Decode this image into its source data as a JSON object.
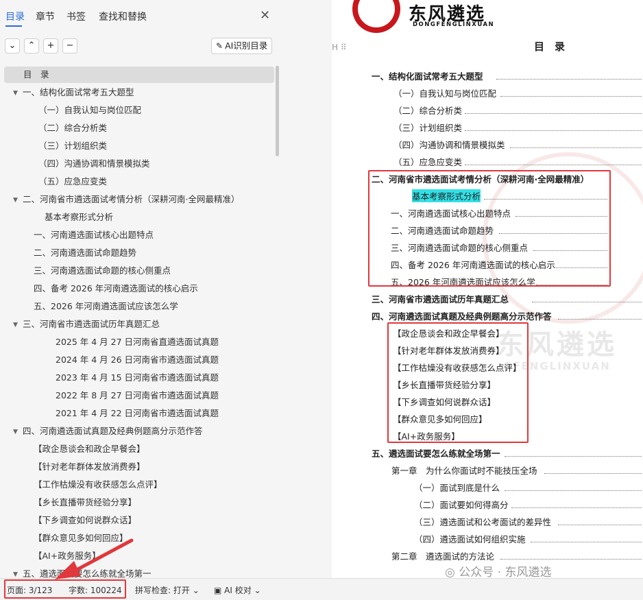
{
  "left_panel": {
    "tabs": [
      "目录",
      "章节",
      "书签",
      "查找和替换"
    ],
    "close_icon": "close-icon",
    "toolbar": {
      "ai_button": "AI识别目录"
    },
    "toc": [
      "目　录",
      "一、结构化面试常考五大题型",
      "（一）自我认知与岗位匹配",
      "（二）综合分析类",
      "（三）计划组织类",
      "（四）沟通协调和情景模拟类",
      "（五）应急应变类",
      "二、河南省市遴选面试考情分析（深耕河南·全网最精准）",
      "基本考察形式分析",
      "一、河南遴选面试核心出题特点",
      "二、河南遴选面试命题趋势",
      "三、河南遴选面试命题的核心侧重点",
      "四、备考 2026 年河南遴选面试的核心启示",
      "五、2026 年河南遴选面试应该怎么学",
      "三、河南省市遴选面试历年真题汇总",
      "2025 年 4 月 27 日河南省直遴选面试真题",
      "2024 年 4 月 26 日河南省市遴选面试真题",
      "2023 年 4 月 15 日河南省市遴选面试真题",
      "2022 年 8 月 27 日河南省市遴选面试真题",
      "2021 年 4 月 22 日河南省市遴选面试真题",
      "四、河南遴选面试真题及经典例题高分示范作答",
      "【政企恳谈会和政企早餐会】",
      "【针对老年群体发放消费券】",
      "【工作枯燥没有收获感怎么点评】",
      "【乡长直播带货经验分享】",
      "【下乡调查如何说群众话】",
      "【群众意见多如何回应】",
      "【AI+政务服务】",
      "五、遴选面试要怎么练就全场第一"
    ]
  },
  "status_bar": {
    "page": "页面: 3/123",
    "words": "字数: 100224",
    "spell": "拼写检查: 打开",
    "ai_check": "AI 校对"
  },
  "document": {
    "logo_text": "东风遴选",
    "logo_sub": "DONGFENGLINXUAN",
    "title": "目　录",
    "lines": [
      "一、结构化面试常考五大题型",
      "（一）自我认知与岗位匹配",
      "（二）综合分析类",
      "（三）计划组织类",
      "（四）沟通协调和情景模拟类",
      "（五）应急应变类",
      "二、河南省市遴选面试考情分析（深耕河南·全网最精准）",
      "基本考察形式分析",
      "一、河南遴选面试核心出题特点",
      "二、河南遴选面试命题趋势",
      "三、河南遴选面试命题的核心侧重点",
      "四、备考 2026 年河南遴选面试的核心启示",
      "五、2026 年河南遴选面试应该怎么学",
      "三、河南省市遴选面试历年真题汇总",
      "四、河南遴选面试真题及经典例题高分示范作答",
      "【政企恳谈会和政企早餐会】",
      "【针对老年群体发放消费券】",
      "【工作枯燥没有收获感怎么点评】",
      "【乡长直播带货经验分享】",
      "【下乡调查如何说群众话】",
      "【群众意见多如何回应】",
      "【AI+政务服务】",
      "五、遴选面试要怎么练就全场第一",
      "第一章　为什么你面试时不能技压全场",
      "（一）面试到底是什么",
      "（二）面试要如何得高分",
      "（三）遴选面试和公考面试的差异性",
      "（四）遴选面试如何组织实施",
      "第二章　遴选面试的方法论"
    ],
    "watermark": "东风遴选",
    "watermark_sub": "GFENGLINXUAN",
    "wechat": "公众号 · 东风遴选"
  }
}
